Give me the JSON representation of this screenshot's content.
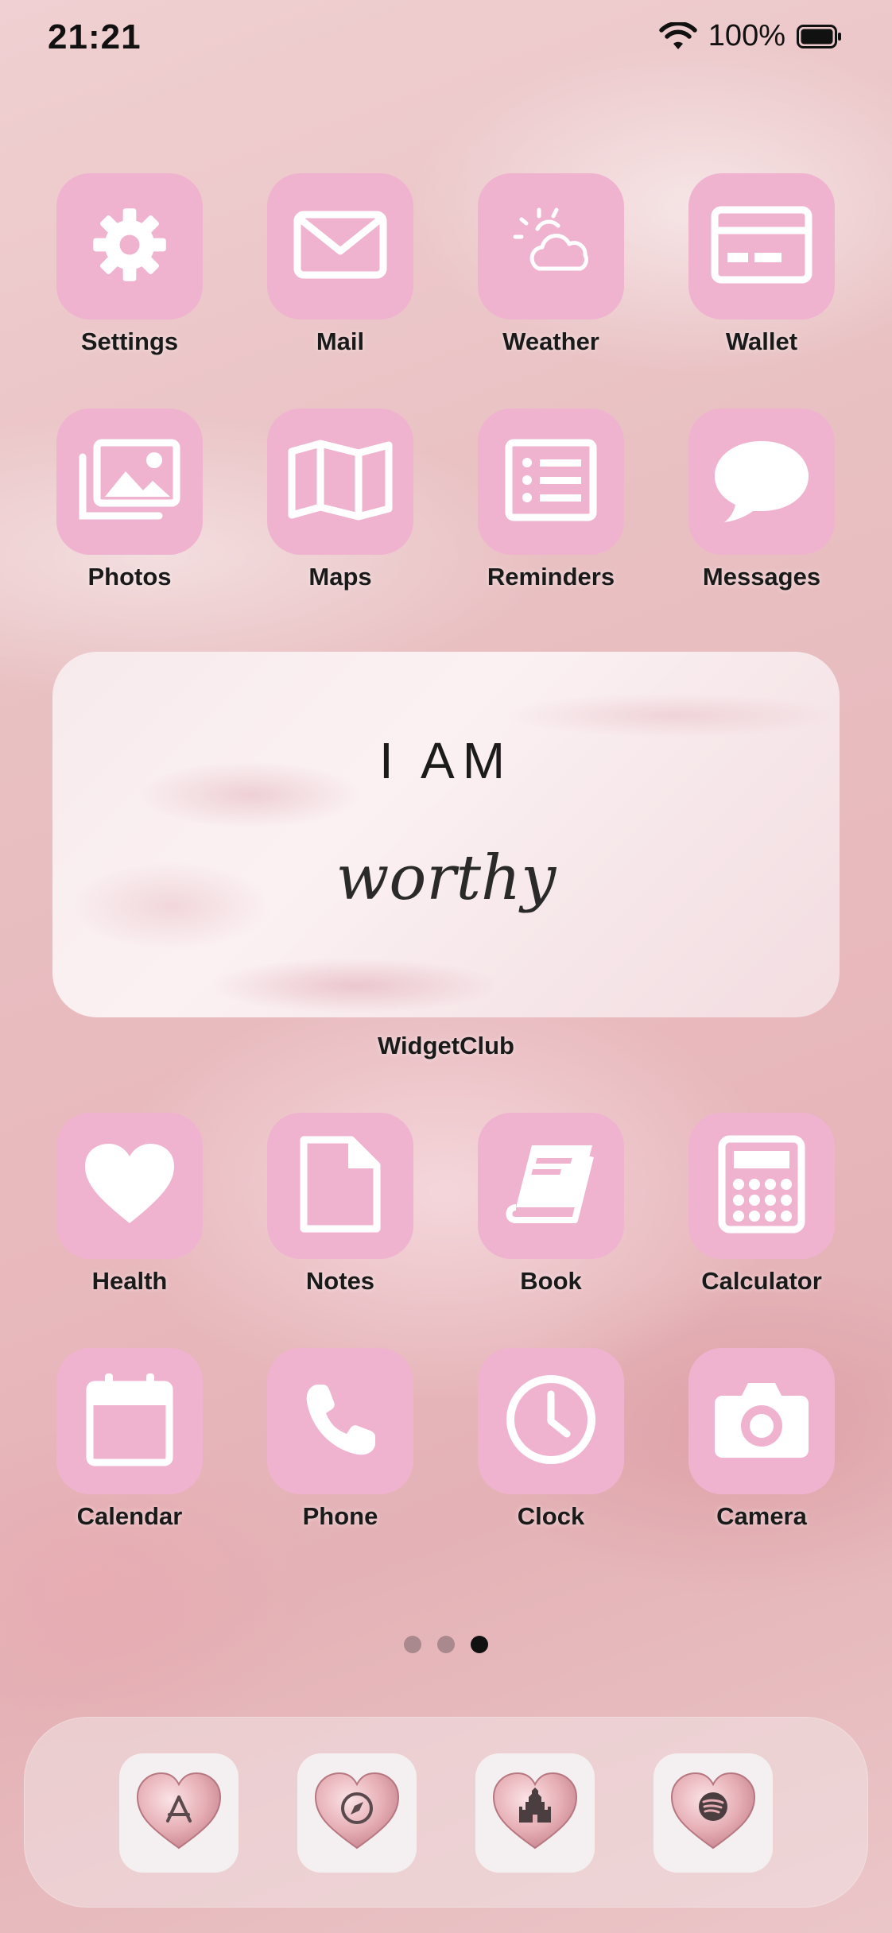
{
  "status_bar": {
    "time": "21:21",
    "battery": "100%"
  },
  "apps_row1": [
    {
      "label": "Settings",
      "icon": "gear-icon"
    },
    {
      "label": "Mail",
      "icon": "mail-icon"
    },
    {
      "label": "Weather",
      "icon": "weather-icon"
    },
    {
      "label": "Wallet",
      "icon": "wallet-icon"
    }
  ],
  "apps_row2": [
    {
      "label": "Photos",
      "icon": "photos-icon"
    },
    {
      "label": "Maps",
      "icon": "map-icon"
    },
    {
      "label": "Reminders",
      "icon": "reminders-icon"
    },
    {
      "label": "Messages",
      "icon": "speech-bubble-icon"
    }
  ],
  "widget": {
    "line1": "I AM",
    "line2": "worthy",
    "label": "WidgetClub"
  },
  "apps_row3": [
    {
      "label": "Health",
      "icon": "heart-icon"
    },
    {
      "label": "Notes",
      "icon": "note-icon"
    },
    {
      "label": "Book",
      "icon": "book-icon"
    },
    {
      "label": "Calculator",
      "icon": "calculator-icon"
    }
  ],
  "apps_row4": [
    {
      "label": "Calendar",
      "icon": "calendar-icon"
    },
    {
      "label": "Phone",
      "icon": "phone-icon"
    },
    {
      "label": "Clock",
      "icon": "clock-icon"
    },
    {
      "label": "Camera",
      "icon": "camera-icon"
    }
  ],
  "page_indicator": {
    "count": 3,
    "active": 3
  },
  "dock": [
    {
      "icon": "app-store-heart-icon"
    },
    {
      "icon": "safari-compass-heart-icon"
    },
    {
      "icon": "castle-heart-icon"
    },
    {
      "icon": "spotify-heart-icon"
    }
  ],
  "colors": {
    "tile": "#f0b3cf",
    "icon_glyph": "#ffffff",
    "label_text": "#1a1a1a",
    "dock_tile": "#f4eff0"
  }
}
